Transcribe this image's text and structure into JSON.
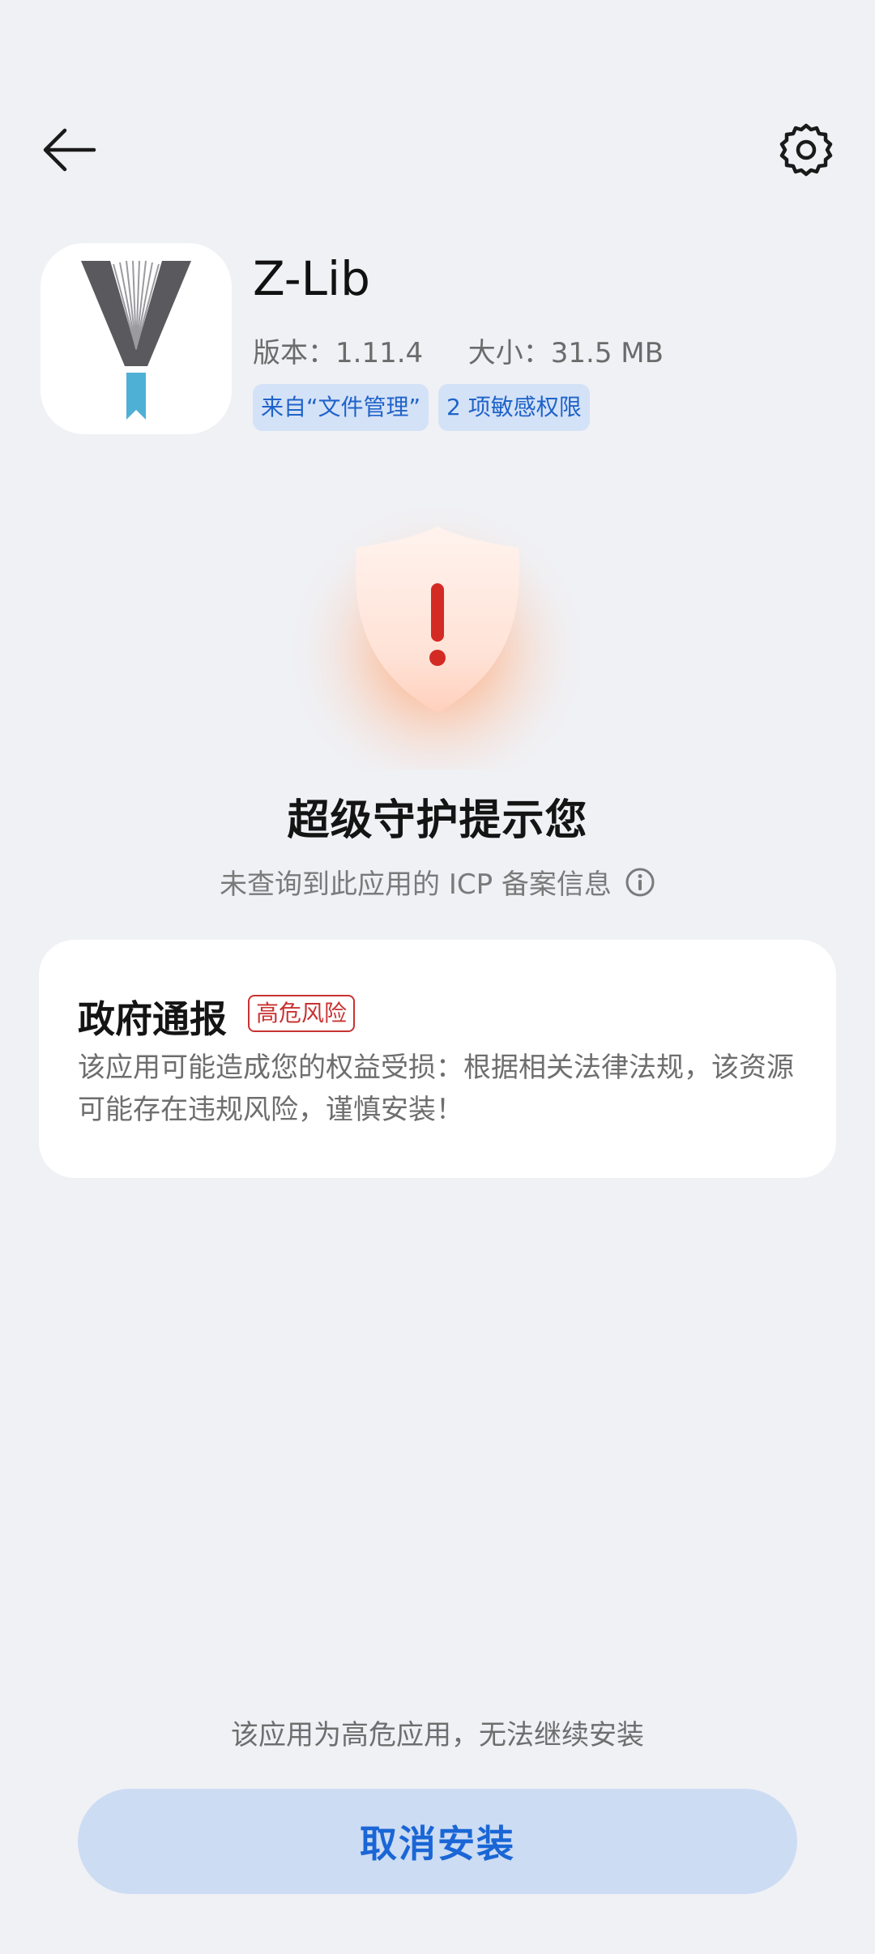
{
  "app": {
    "name": "Z-Lib",
    "version_label": "版本：1.11.4",
    "size_label": "大小：31.5 MB",
    "tags": [
      "来自“文件管理”",
      "2 项敏感权限"
    ]
  },
  "protection": {
    "title": "超级守护提示您",
    "subtitle": "未查询到此应用的 ICP 备案信息"
  },
  "report_card": {
    "title": "政府通报",
    "badge": "高危风险",
    "description": "该应用可能造成您的权益受损：根据相关法律法规，该资源可能存在违规风险，谨慎安装！"
  },
  "footer": {
    "note": "该应用为高危应用，无法继续安装",
    "cancel_label": "取消安装"
  },
  "colors": {
    "background": "#f0f1f5",
    "accent_blue": "#1a66d6",
    "tag_bg": "#d4e2f7",
    "risk_red": "#c93232",
    "button_bg": "#ccdcf3"
  },
  "icons": {
    "back": "arrow-left-icon",
    "settings": "gear-icon",
    "info": "info-circle-icon",
    "shield": "shield-warning-icon"
  }
}
